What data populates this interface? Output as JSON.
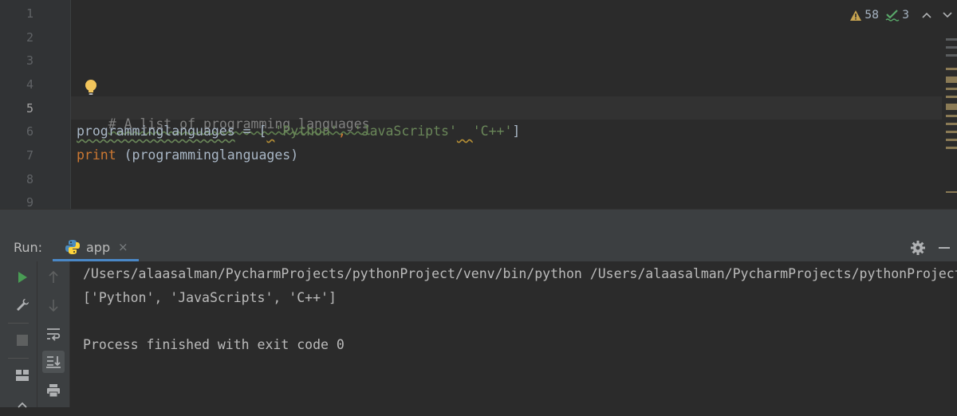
{
  "editor": {
    "line_numbers": [
      "1",
      "2",
      "3",
      "4",
      "5",
      "6",
      "7",
      "8",
      "9"
    ],
    "current_line": "5",
    "code": {
      "line5_comment": "# A list of programming languages",
      "line6_var": "programminglanguages",
      "line6_assign": " = [",
      "line6_gap1": " ",
      "line6_str1": "'Python'",
      "line6_comma1": ", ",
      "line6_str2": "'JavaScripts'",
      "line6_gap2": "  ",
      "line6_str3": "'C++'",
      "line6_close": "]",
      "line7_kw": "print",
      "line7_rest": " (programminglanguages)"
    },
    "inspections": {
      "warnings": "58",
      "typos": "3"
    }
  },
  "run": {
    "label": "Run:",
    "tab_label": "app",
    "tab_close": "×"
  },
  "console": {
    "lines": [
      "/Users/alaasalman/PycharmProjects/pythonProject/venv/bin/python /Users/alaasalman/PycharmProjects/pythonProject/app.py",
      "['Python', 'JavaScripts', 'C++']",
      "",
      "Process finished with exit code 0"
    ]
  },
  "icons": {
    "bulb": "lightbulb-icon",
    "warning": "warning-icon",
    "typo": "typo-check-icon",
    "run": "run-icon",
    "wrench": "wrench-icon",
    "stop": "stop-icon",
    "layout": "layout-icon",
    "up": "arrow-up-icon",
    "down": "arrow-down-icon",
    "wrap": "soft-wrap-icon",
    "scroll_end": "scroll-to-end-icon",
    "print": "print-icon",
    "settings": "gear-icon",
    "minimize": "minimize-icon"
  },
  "colors": {
    "background": "#2b2b2b",
    "comment": "#808080",
    "string": "#6a8759",
    "keyword": "#cc7832",
    "accent": "#4a88c7",
    "run_green": "#499c54"
  }
}
